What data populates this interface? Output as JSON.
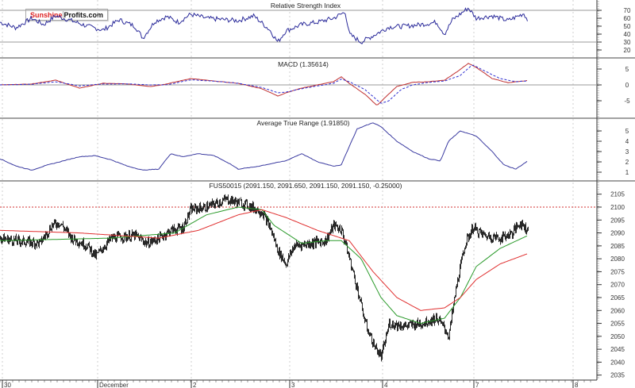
{
  "logo": {
    "part1": "Sunshine",
    "part2": "Profits.com"
  },
  "chart_data": [
    {
      "type": "line",
      "title": "Relative Strength Index",
      "ylim": [
        10,
        83
      ],
      "yticks": [
        70,
        60,
        50,
        40,
        30,
        20
      ],
      "reference_lines": [
        70,
        30
      ],
      "series": [
        {
          "name": "RSI",
          "color": "#2a2a9a",
          "x": [
            0,
            20,
            40,
            55,
            70,
            90,
            110,
            130,
            150,
            170,
            180,
            195,
            210,
            225,
            240,
            260,
            285,
            300,
            320,
            340,
            350,
            360,
            380,
            400,
            420,
            435,
            440,
            455,
            470,
            490,
            510,
            530,
            550,
            560,
            570,
            590,
            600,
            620,
            640,
            660,
            665
          ],
          "y": [
            55,
            48,
            60,
            52,
            63,
            57,
            50,
            45,
            58,
            50,
            35,
            56,
            62,
            55,
            65,
            60,
            58,
            57,
            63,
            45,
            30,
            44,
            52,
            55,
            60,
            68,
            40,
            30,
            38,
            49,
            50,
            52,
            55,
            40,
            58,
            73,
            60,
            63,
            57,
            66,
            57
          ]
        }
      ]
    },
    {
      "type": "line",
      "title": "MACD (1.35614)",
      "ylim": [
        -10,
        9
      ],
      "yticks": [
        5,
        0,
        -5
      ],
      "reference_lines": [
        0
      ],
      "series": [
        {
          "name": "MACD",
          "color": "#c03030",
          "x": [
            0,
            40,
            70,
            100,
            130,
            160,
            190,
            210,
            240,
            270,
            300,
            330,
            350,
            360,
            380,
            400,
            420,
            430,
            440,
            460,
            475,
            485,
            500,
            520,
            540,
            560,
            575,
            590,
            600,
            620,
            640,
            665
          ],
          "y": [
            0,
            0.3,
            1.5,
            -1,
            0.5,
            0.3,
            -0.5,
            0.3,
            2,
            1.2,
            0.5,
            -1.2,
            -3.5,
            -2.5,
            -1,
            0,
            1,
            2.5,
            0.5,
            -3,
            -6.5,
            -4,
            -0.5,
            0.8,
            1,
            1.5,
            4,
            6.8,
            5.5,
            2,
            0.7,
            1.4
          ]
        },
        {
          "name": "Signal",
          "color": "#3030d0",
          "dashed": true,
          "x": [
            0,
            40,
            70,
            100,
            130,
            160,
            190,
            210,
            240,
            270,
            300,
            330,
            350,
            360,
            380,
            400,
            420,
            430,
            440,
            460,
            480,
            490,
            505,
            520,
            540,
            560,
            580,
            595,
            610,
            630,
            650,
            665
          ],
          "y": [
            0,
            0.2,
            1,
            -0.3,
            0.3,
            0.3,
            0,
            0,
            1.6,
            1.2,
            0.5,
            -0.8,
            -2.5,
            -2.3,
            -1.2,
            -0.3,
            0.5,
            1.8,
            1,
            -1.5,
            -5.8,
            -5,
            -1.5,
            0,
            0.8,
            1.2,
            3,
            6.3,
            4.5,
            2,
            1,
            1.3
          ]
        }
      ]
    },
    {
      "type": "line",
      "title": "Average True Range (1.91850)",
      "ylim": [
        0,
        6.3
      ],
      "yticks": [
        5,
        4,
        3,
        2,
        1
      ],
      "series": [
        {
          "name": "ATR",
          "color": "#3a3aa0",
          "x": [
            0,
            20,
            40,
            60,
            80,
            100,
            120,
            140,
            160,
            180,
            200,
            215,
            230,
            250,
            270,
            290,
            300,
            320,
            340,
            360,
            380,
            400,
            420,
            430,
            440,
            450,
            470,
            480,
            500,
            520,
            540,
            555,
            565,
            580,
            600,
            620,
            635,
            650,
            665
          ],
          "y": [
            2.3,
            1.6,
            1.2,
            1.7,
            2.1,
            2.5,
            2.6,
            2.2,
            1.6,
            1.2,
            1.3,
            2.8,
            2.5,
            2.8,
            2.6,
            1.8,
            1.3,
            1.5,
            1.8,
            2.1,
            2.8,
            2.0,
            1.6,
            1.7,
            3.5,
            5.2,
            5.8,
            5.4,
            4.0,
            3.0,
            2.3,
            2.1,
            4.0,
            5.0,
            4.5,
            3.0,
            1.7,
            1.3,
            2.1
          ]
        }
      ]
    },
    {
      "type": "line",
      "title": "FUS50015 (2091.150, 2091.650, 2091.150, 2091.150, -0.25000)",
      "ylim": [
        2033,
        2110
      ],
      "yticks": [
        2105,
        2100,
        2095,
        2090,
        2085,
        2080,
        2075,
        2070,
        2065,
        2060,
        2055,
        2050,
        2045,
        2040,
        2035
      ],
      "reference_lines": [
        2100
      ],
      "xticks": {
        "bars": [
          3,
          123,
          241,
          365,
          482,
          597,
          722
        ],
        "labels": [
          "30",
          "December",
          "2",
          "3",
          "4",
          "7",
          "8"
        ]
      },
      "series": [
        {
          "name": "Price",
          "color": "#111111",
          "x": [
            0,
            20,
            50,
            65,
            75,
            90,
            110,
            120,
            140,
            170,
            185,
            200,
            215,
            230,
            240,
            260,
            285,
            310,
            330,
            340,
            350,
            360,
            370,
            390,
            410,
            420,
            430,
            440,
            450,
            460,
            470,
            480,
            490,
            510,
            530,
            550,
            560,
            565,
            575,
            585,
            595,
            610,
            630,
            645,
            655,
            665
          ],
          "y": [
            2088,
            2087,
            2086,
            2093,
            2094,
            2088,
            2085,
            2081,
            2088,
            2089,
            2086,
            2088,
            2091,
            2092,
            2099,
            2100,
            2103,
            2101,
            2098,
            2092,
            2083,
            2078,
            2085,
            2086,
            2087,
            2093,
            2091,
            2080,
            2068,
            2055,
            2047,
            2042,
            2055,
            2054,
            2055,
            2057,
            2053,
            2050,
            2070,
            2085,
            2092,
            2089,
            2088,
            2090,
            2094,
            2091
          ]
        },
        {
          "name": "Short MA",
          "color": "#2a9a2a",
          "x": [
            0,
            140,
            220,
            260,
            300,
            330,
            345,
            380,
            410,
            430,
            455,
            480,
            500,
            530,
            560,
            580,
            600,
            630,
            665
          ],
          "y": [
            2087,
            2088,
            2090,
            2097,
            2100,
            2099,
            2093,
            2086,
            2087,
            2087,
            2080,
            2065,
            2058,
            2055,
            2057,
            2065,
            2077,
            2084,
            2089
          ]
        },
        {
          "name": "Long MA",
          "color": "#e03030",
          "x": [
            0,
            100,
            200,
            250,
            300,
            330,
            360,
            400,
            440,
            470,
            500,
            530,
            560,
            580,
            600,
            630,
            665
          ],
          "y": [
            2091,
            2090,
            2088,
            2091,
            2097,
            2099,
            2096,
            2091,
            2087,
            2075,
            2065,
            2060,
            2061,
            2065,
            2072,
            2078,
            2082
          ]
        }
      ]
    }
  ]
}
